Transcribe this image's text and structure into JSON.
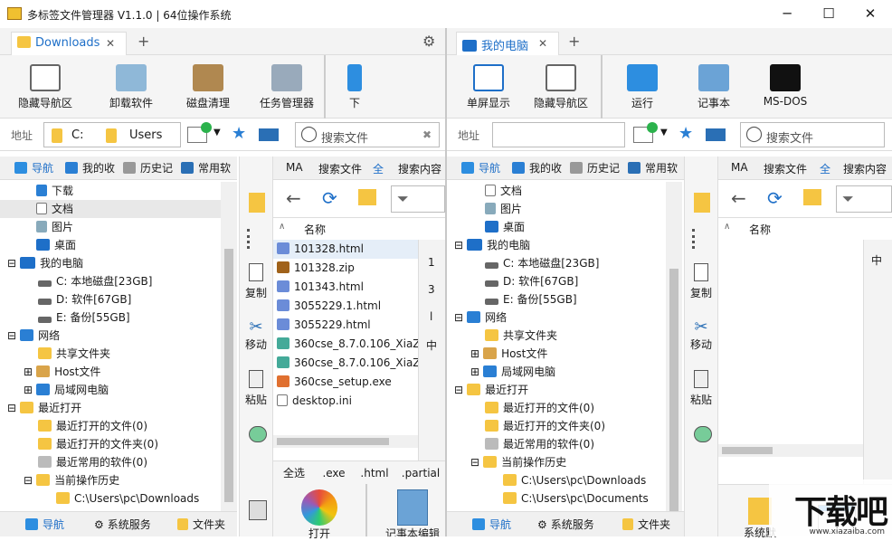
{
  "window": {
    "title": "多标签文件管理器 V1.1.0 | 64位操作系统",
    "minimize": "─",
    "maximize": "☐",
    "close": "✕"
  },
  "left": {
    "tab": {
      "label": "Downloads",
      "close": "✕",
      "add": "+"
    },
    "toolbar": [
      "隐藏导航区",
      "卸载软件",
      "磁盘清理",
      "任务管理器",
      "下"
    ],
    "address": {
      "label": "地址",
      "drive": "C:",
      "folder": "Users",
      "search_placeholder": "搜索文件"
    },
    "navtabs": [
      "导航",
      "我的收",
      "历史记",
      "常用软"
    ],
    "tree": [
      "下载",
      "文档",
      "图片",
      "桌面",
      "我的电脑",
      "C: 本地磁盘[23GB]",
      "D: 软件[67GB]",
      "E: 备份[55GB]",
      "网络",
      "共享文件夹",
      "Host文件",
      "局域网电脑",
      "最近打开",
      "最近打开的文件(0)",
      "最近打开的文件夹(0)",
      "最近常用的软件(0)",
      "当前操作历史",
      "C:\\Users\\pc\\Downloads"
    ],
    "bottom_tabs": [
      "导航",
      "系统服务",
      "文件夹"
    ],
    "side_buttons": [
      "复制",
      "移动",
      "粘贴"
    ],
    "file_tabs": [
      "MA",
      "搜索文件",
      "全",
      "搜索内容"
    ],
    "column": "名称",
    "files": [
      "101328.html",
      "101328.zip",
      "101343.html",
      "3055229.1.html",
      "3055229.html",
      "360cse_8.7.0.106_XiaZai",
      "360cse_8.7.0.106_XiaZai",
      "360cse_setup.exe",
      "desktop.ini"
    ],
    "index": [
      "1",
      "3",
      "l",
      "中"
    ],
    "filter_tabs": [
      "全选",
      ".exe",
      ".html",
      ".partial"
    ],
    "apps": [
      "打开",
      "记事本编辑"
    ]
  },
  "right": {
    "tab": {
      "label": "我的电脑",
      "close": "✕",
      "add": "+"
    },
    "toolbar": [
      "单屏显示",
      "隐藏导航区",
      "运行",
      "记事本",
      "MS-DOS"
    ],
    "address": {
      "label": "地址",
      "search_placeholder": "搜索文件"
    },
    "navtabs": [
      "导航",
      "我的收",
      "历史记",
      "常用软"
    ],
    "tree": [
      "文档",
      "图片",
      "桌面",
      "我的电脑",
      "C: 本地磁盘[23GB]",
      "D: 软件[67GB]",
      "E: 备份[55GB]",
      "网络",
      "共享文件夹",
      "Host文件",
      "局域网电脑",
      "最近打开",
      "最近打开的文件(0)",
      "最近打开的文件夹(0)",
      "最近常用的软件(0)",
      "当前操作历史",
      "C:\\Users\\pc\\Downloads",
      "C:\\Users\\pc\\Documents"
    ],
    "bottom_tabs": [
      "导航",
      "系统服务",
      "文件夹"
    ],
    "side_buttons": [
      "复制",
      "移动",
      "粘贴"
    ],
    "file_tabs": [
      "MA",
      "搜索文件",
      "全",
      "搜索内容"
    ],
    "column": "名称",
    "index": [
      "中"
    ],
    "apps": [
      "系统默"
    ]
  },
  "watermark": {
    "main": "下载吧",
    "sub": "www.xiazaiba.com"
  },
  "colors": {
    "accent": "#1e6fc8",
    "folder": "#f5c542",
    "toolbar_bg": "#f5f5f5"
  }
}
